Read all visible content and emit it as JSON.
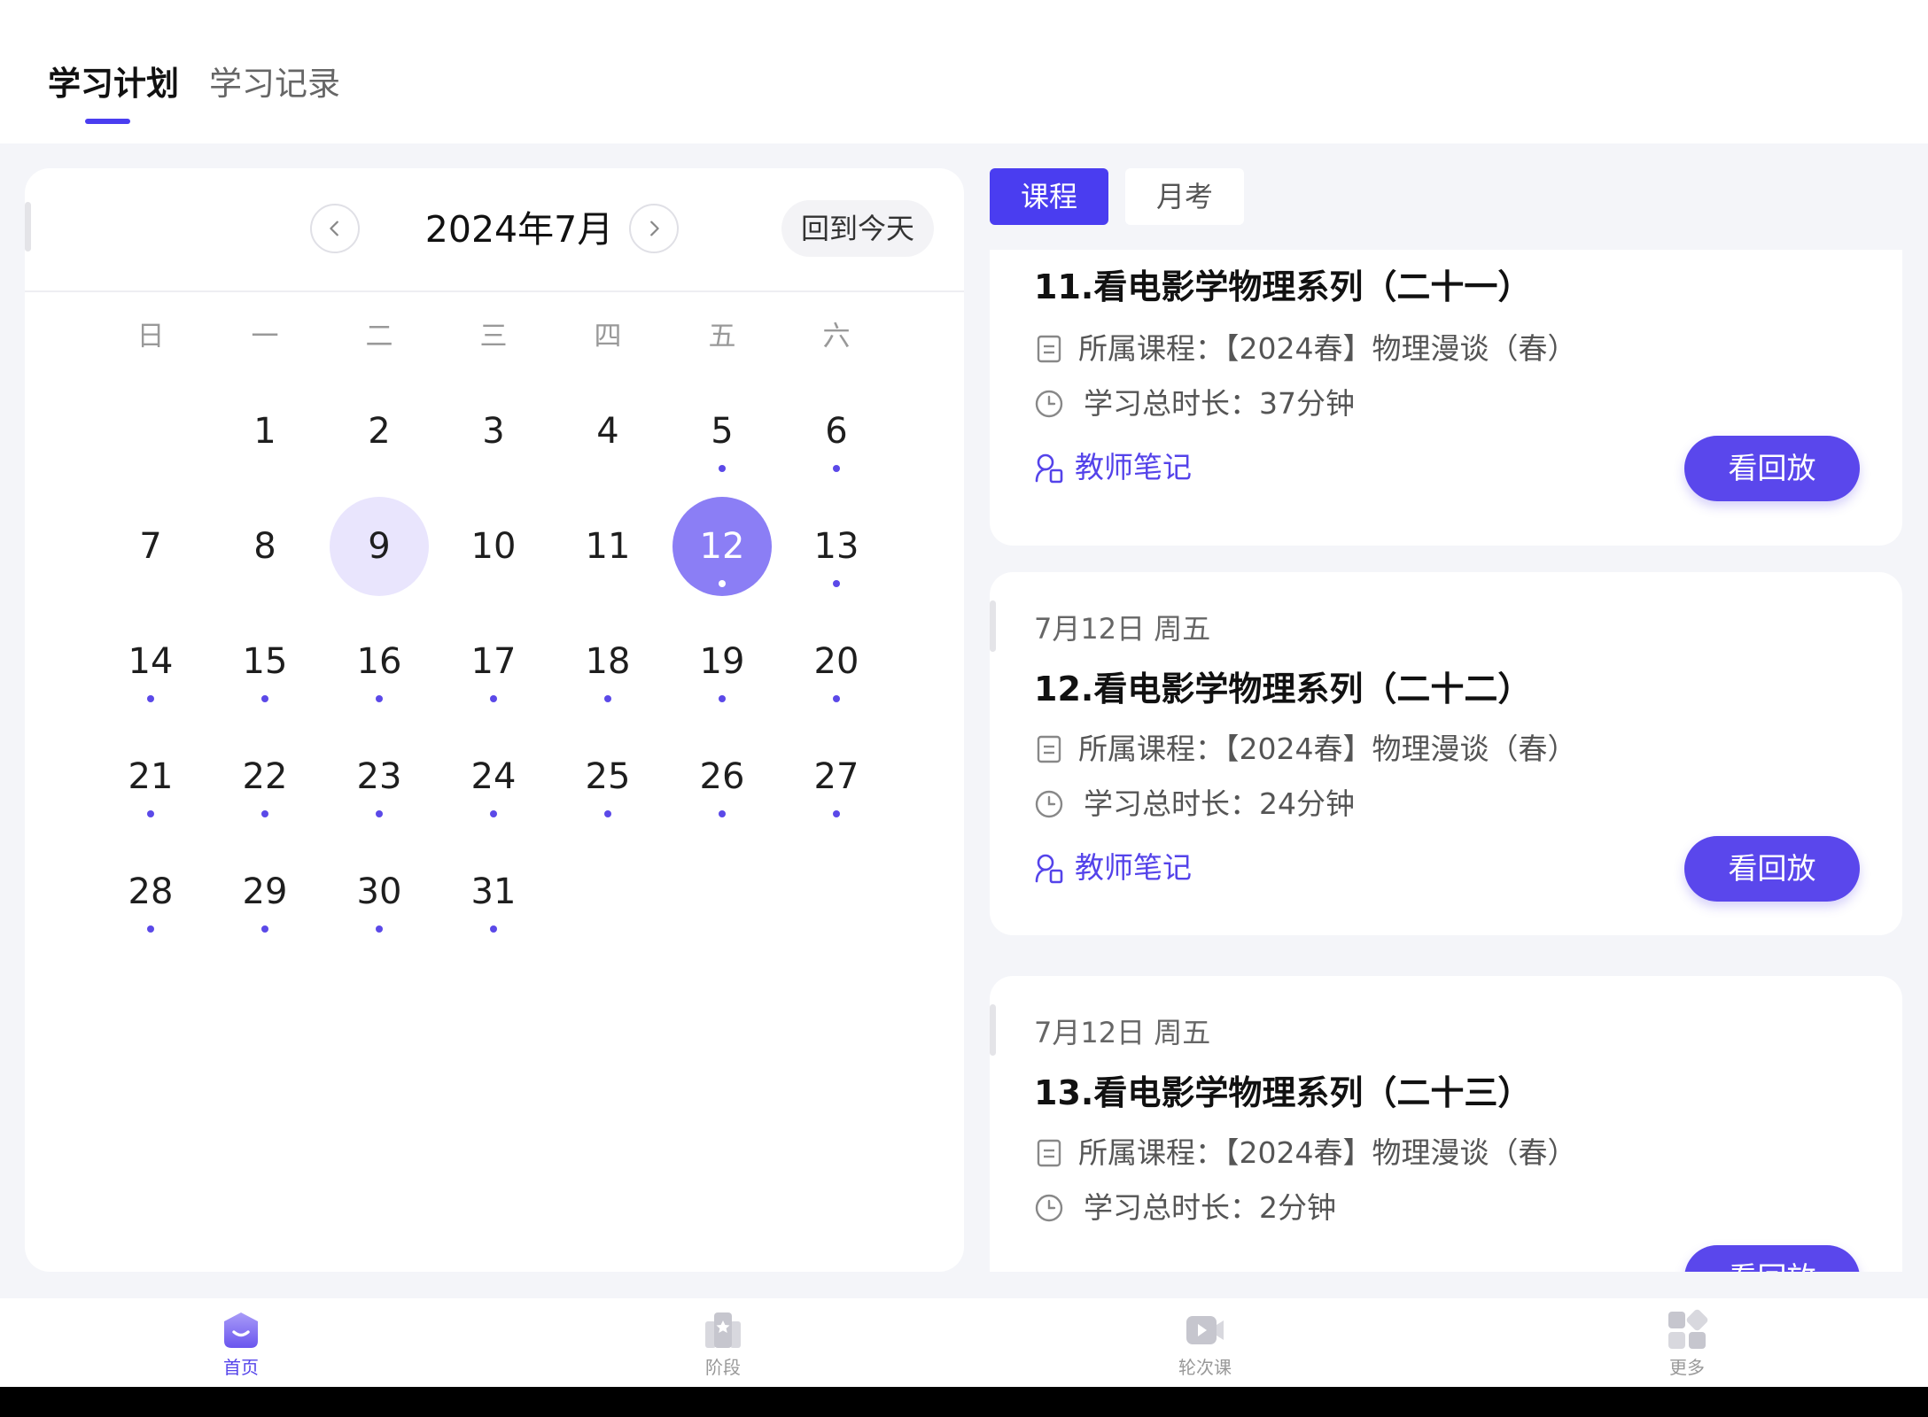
{
  "header": {
    "tabs": [
      {
        "label": "学习计划",
        "active": true
      },
      {
        "label": "学习记录",
        "active": false
      }
    ]
  },
  "calendar": {
    "month_title": "2024年7月",
    "today_button": "回到今天",
    "weekdays": [
      "日",
      "一",
      "二",
      "三",
      "四",
      "五",
      "六"
    ],
    "first_weekday_index": 1,
    "days": [
      "1",
      "2",
      "3",
      "4",
      "5",
      "6",
      "7",
      "8",
      "9",
      "10",
      "11",
      "12",
      "13",
      "14",
      "15",
      "16",
      "17",
      "18",
      "19",
      "20",
      "21",
      "22",
      "23",
      "24",
      "25",
      "26",
      "27",
      "28",
      "29",
      "30",
      "31"
    ],
    "days_with_lessons": [
      5,
      6,
      12,
      13,
      14,
      15,
      16,
      17,
      18,
      19,
      20,
      21,
      22,
      23,
      24,
      25,
      26,
      27,
      28,
      29,
      30,
      31
    ],
    "selected_day": 9,
    "today": 12
  },
  "content_tabs": [
    {
      "label": "课程",
      "active": true
    },
    {
      "label": "月考",
      "active": false
    }
  ],
  "lessons": [
    {
      "date": "",
      "title": "11.看电影学物理系列（二十一）",
      "course": "所属课程：【2024春】物理漫谈（春）",
      "duration": "学习总时长：37分钟",
      "notes_label": "教师笔记",
      "replay_label": "看回放"
    },
    {
      "date": "7月12日 周五",
      "title": "12.看电影学物理系列（二十二）",
      "course": "所属课程：【2024春】物理漫谈（春）",
      "duration": "学习总时长：24分钟",
      "notes_label": "教师笔记",
      "replay_label": "看回放"
    },
    {
      "date": "7月12日 周五",
      "title": "13.看电影学物理系列（二十三）",
      "course": "所属课程：【2024春】物理漫谈（春）",
      "duration": "学习总时长：2分钟",
      "notes_label": "",
      "replay_label": "看回放"
    }
  ],
  "bottom_nav": [
    {
      "label": "首页",
      "icon": "home-icon",
      "active": true
    },
    {
      "label": "阶段",
      "icon": "stage-icon",
      "active": false
    },
    {
      "label": "轮次课",
      "icon": "video-icon",
      "active": false
    },
    {
      "label": "更多",
      "icon": "grid-icon",
      "active": false
    }
  ],
  "colors": {
    "accent": "#4a3df0",
    "button": "#5a47ec",
    "today_circle": "#8b7ef5",
    "selected_circle": "#e9e5fd"
  }
}
